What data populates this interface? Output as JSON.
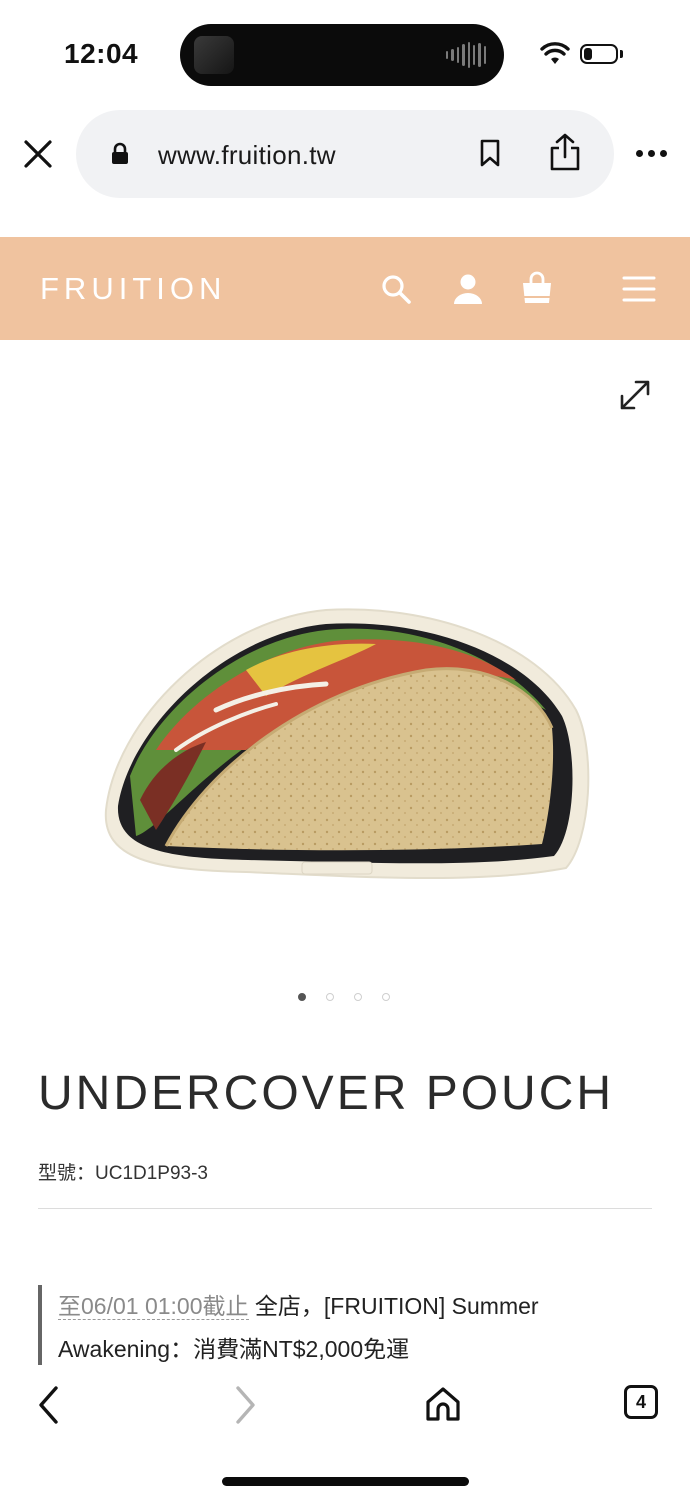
{
  "status_bar": {
    "time": "12:04"
  },
  "browser": {
    "url": "www.fruition.tw",
    "tab_count": "4"
  },
  "site": {
    "logo": "FRUITION",
    "header_color": "#f0c39f"
  },
  "product": {
    "title": "UNDERCOVER POUCH",
    "model": "型號：UC1D1P93-3",
    "image_pages": 4,
    "active_page": 1
  },
  "promo": {
    "date_text": "至06/01 01:00截止",
    "text": " 全店，[FRUITION] Summer Awakening：消費滿NT$2,000免運"
  },
  "icons": {
    "close": "close-icon",
    "lock": "lock-icon",
    "bookmark": "bookmark-icon",
    "share": "share-icon",
    "more": "more-icon",
    "search": "search-icon",
    "account": "user-icon",
    "cart": "shopping-bag-icon",
    "menu": "hamburger-menu-icon",
    "expand": "expand-icon",
    "back": "chevron-left-icon",
    "forward": "chevron-right-icon",
    "home": "home-icon",
    "tabs": "tabs-icon"
  }
}
